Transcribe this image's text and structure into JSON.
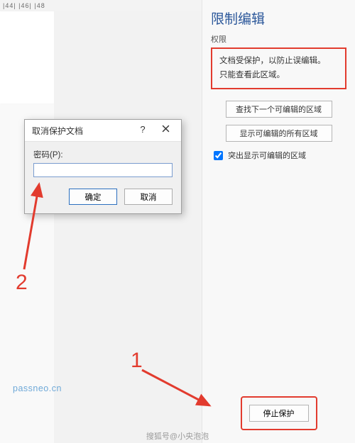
{
  "ruler": {
    "marks": "|44|  |46|  |48"
  },
  "pane": {
    "title": "限制编辑",
    "subheading": "权限",
    "info_line1": "文档受保护，以防止误编辑。",
    "info_line2": "只能查看此区域。",
    "btn_find_next": "查找下一个可编辑的区域",
    "btn_show_all": "显示可编辑的所有区域",
    "chk_highlight": "突出显示可编辑的区域",
    "btn_stop": "停止保护"
  },
  "dialog": {
    "title": "取消保护文档",
    "help_symbol": "?",
    "password_label": "密码(P):",
    "password_value": "",
    "btn_ok": "确定",
    "btn_cancel": "取消"
  },
  "annotations": {
    "num1": "1",
    "num2": "2"
  },
  "watermark": "passneo.cn",
  "footer": "搜狐号@小央泡泡"
}
